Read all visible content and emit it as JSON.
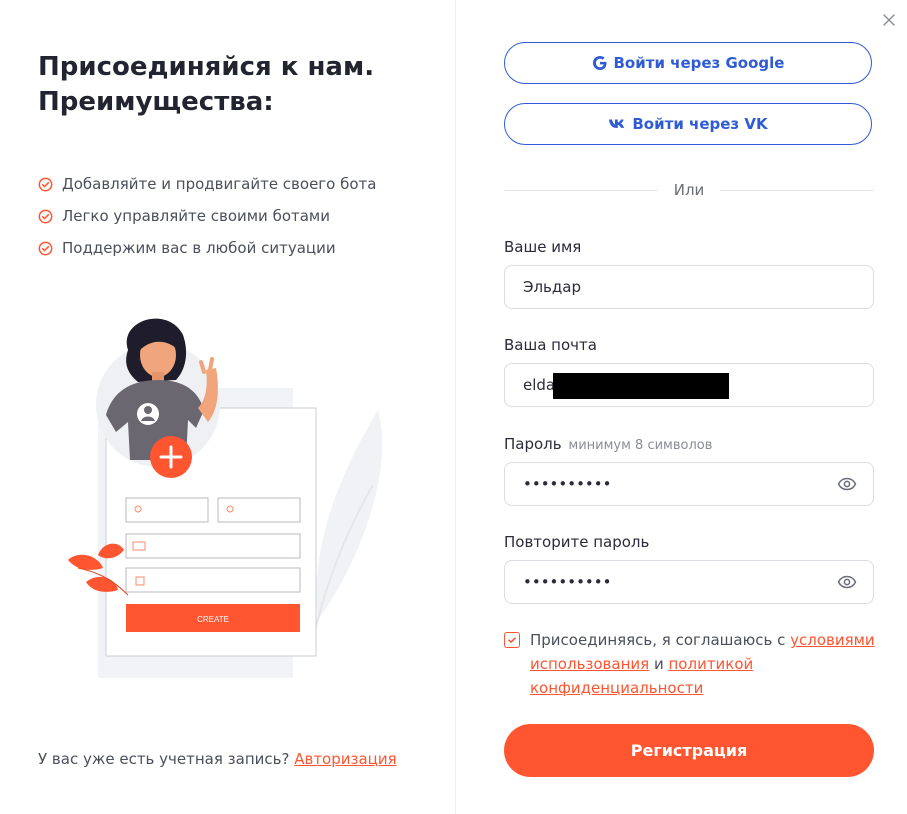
{
  "left": {
    "title_line1": "Присоединяйся к нам.",
    "title_line2": "Преимущества:",
    "benefits": [
      "Добавляйте и продвигайте своего бота",
      "Легко управляйте своими ботами",
      "Поддержим вас в любой ситуации"
    ],
    "illustration_button": "CREATE",
    "account_prompt": "У вас уже есть учетная запись?",
    "login_link": "Авторизация"
  },
  "social": {
    "google_label": "Войти через Google",
    "vk_label": "Войти через VK",
    "or_label": "Или"
  },
  "form": {
    "name_label": "Ваше имя",
    "name_value": "Эльдар",
    "email_label": "Ваша почта",
    "email_value": "elda",
    "password_label": "Пароль",
    "password_hint": "минимум 8 символов",
    "password_value": "••••••••••",
    "repeat_label": "Повторите пароль",
    "repeat_value": "••••••••••",
    "agree_text": "Присоединяясь, я соглашаюсь с",
    "terms_link": "условиями использования",
    "and_text": "и",
    "privacy_link": "политикой конфиденциальности",
    "submit_label": "Регистрация",
    "terms_checked": true
  },
  "colors": {
    "accent": "#ff5530",
    "social_blue": "#2f5bd6",
    "text_dark": "#222430"
  }
}
